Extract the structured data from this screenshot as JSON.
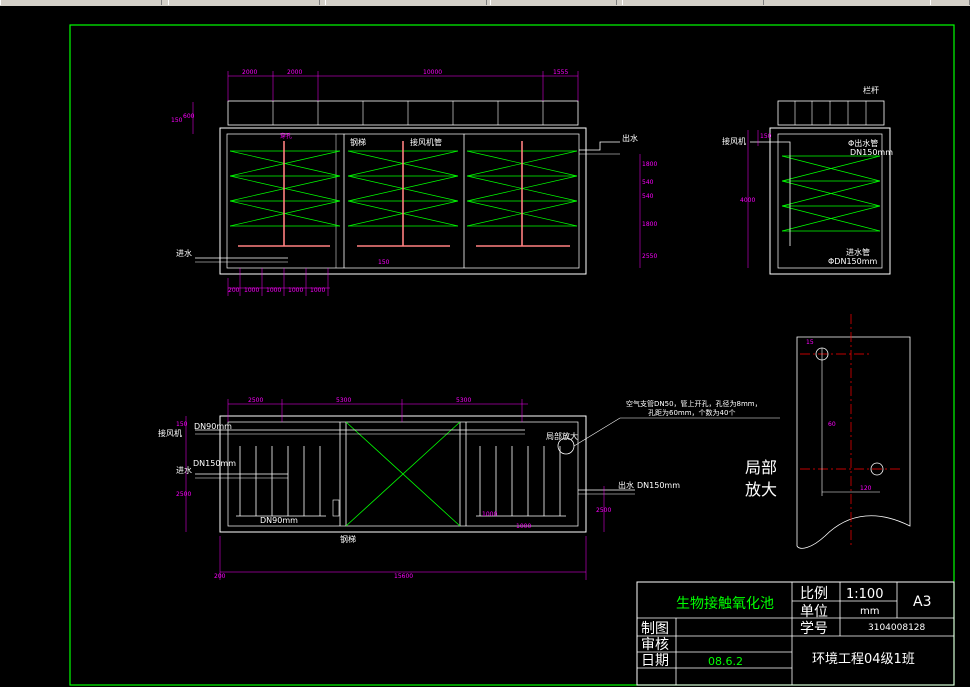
{
  "drawing": {
    "section_top": {
      "dims_top": [
        "2000",
        "2000",
        "10000",
        "1555"
      ],
      "dims_left": [
        "150",
        "600"
      ],
      "dims_right": [
        "1800",
        "540",
        "540",
        "1800",
        "2550"
      ],
      "dims_bottom": [
        "200",
        "1000",
        "1000",
        "1000",
        "1000"
      ],
      "dim_small": "150",
      "label_aerator": "穿孔",
      "label_ladder": "钢梯",
      "label_blower_pipe": "接风机管",
      "label_outlet": "出水",
      "label_inlet": "进水"
    },
    "section_side": {
      "label_railing": "栏杆",
      "label_blower": "接风机",
      "label_outlet_pipe": "Φ出水管",
      "label_outlet_dn": "DN150mm",
      "label_inlet_pipe": "进水管",
      "label_inlet_dn": "ΦDN150mm",
      "dims_left": [
        "150",
        "4000"
      ]
    },
    "plan": {
      "dims_top": [
        "2500",
        "5300",
        "5300"
      ],
      "dim_total": "15600",
      "dims_left": [
        "150",
        "2500"
      ],
      "dims_right": [
        "2500",
        "1000"
      ],
      "dim_mid": "1000",
      "dim_corner": "200",
      "label_blower": "接风机",
      "label_dn90_top": "DN90mm",
      "label_inlet": "进水",
      "label_dn150_left": "DN150mm",
      "label_dn90_bottom": "DN90mm",
      "label_outlet": "出水",
      "label_dn150_right": "DN150mm",
      "label_ladder": "钢梯",
      "label_local": "局部放大",
      "note_line1": "空气支管DN50，管上开孔，孔径为8mm，",
      "note_line2": "孔距为60mm，个数为40个"
    },
    "detail": {
      "title_line1": "局部",
      "title_line2": "放大",
      "dim_hole": "15",
      "dim_spacing": "60",
      "dim_bottom": "120"
    }
  },
  "title_block": {
    "project_title": "生物接触氧化池",
    "scale_label": "比例",
    "scale_value": "1:100",
    "sheet_size": "A3",
    "unit_label": "单位",
    "unit_value": "mm",
    "student_id_label": "学号",
    "student_id_value": "3104008128",
    "drawn_label": "制图",
    "checked_label": "审核",
    "date_label": "日期",
    "date_value": "08.6.2",
    "class_value": "环境工程04级1班"
  },
  "colors": {
    "background": "#000000",
    "frame": "#00ff00",
    "lines": "#ffffff",
    "dimensions": "#ff00ff",
    "centerline": "#ff0000",
    "aeration_pipe": "#ff8080",
    "title_green": "#00ff00",
    "title_white": "#ffffff"
  }
}
